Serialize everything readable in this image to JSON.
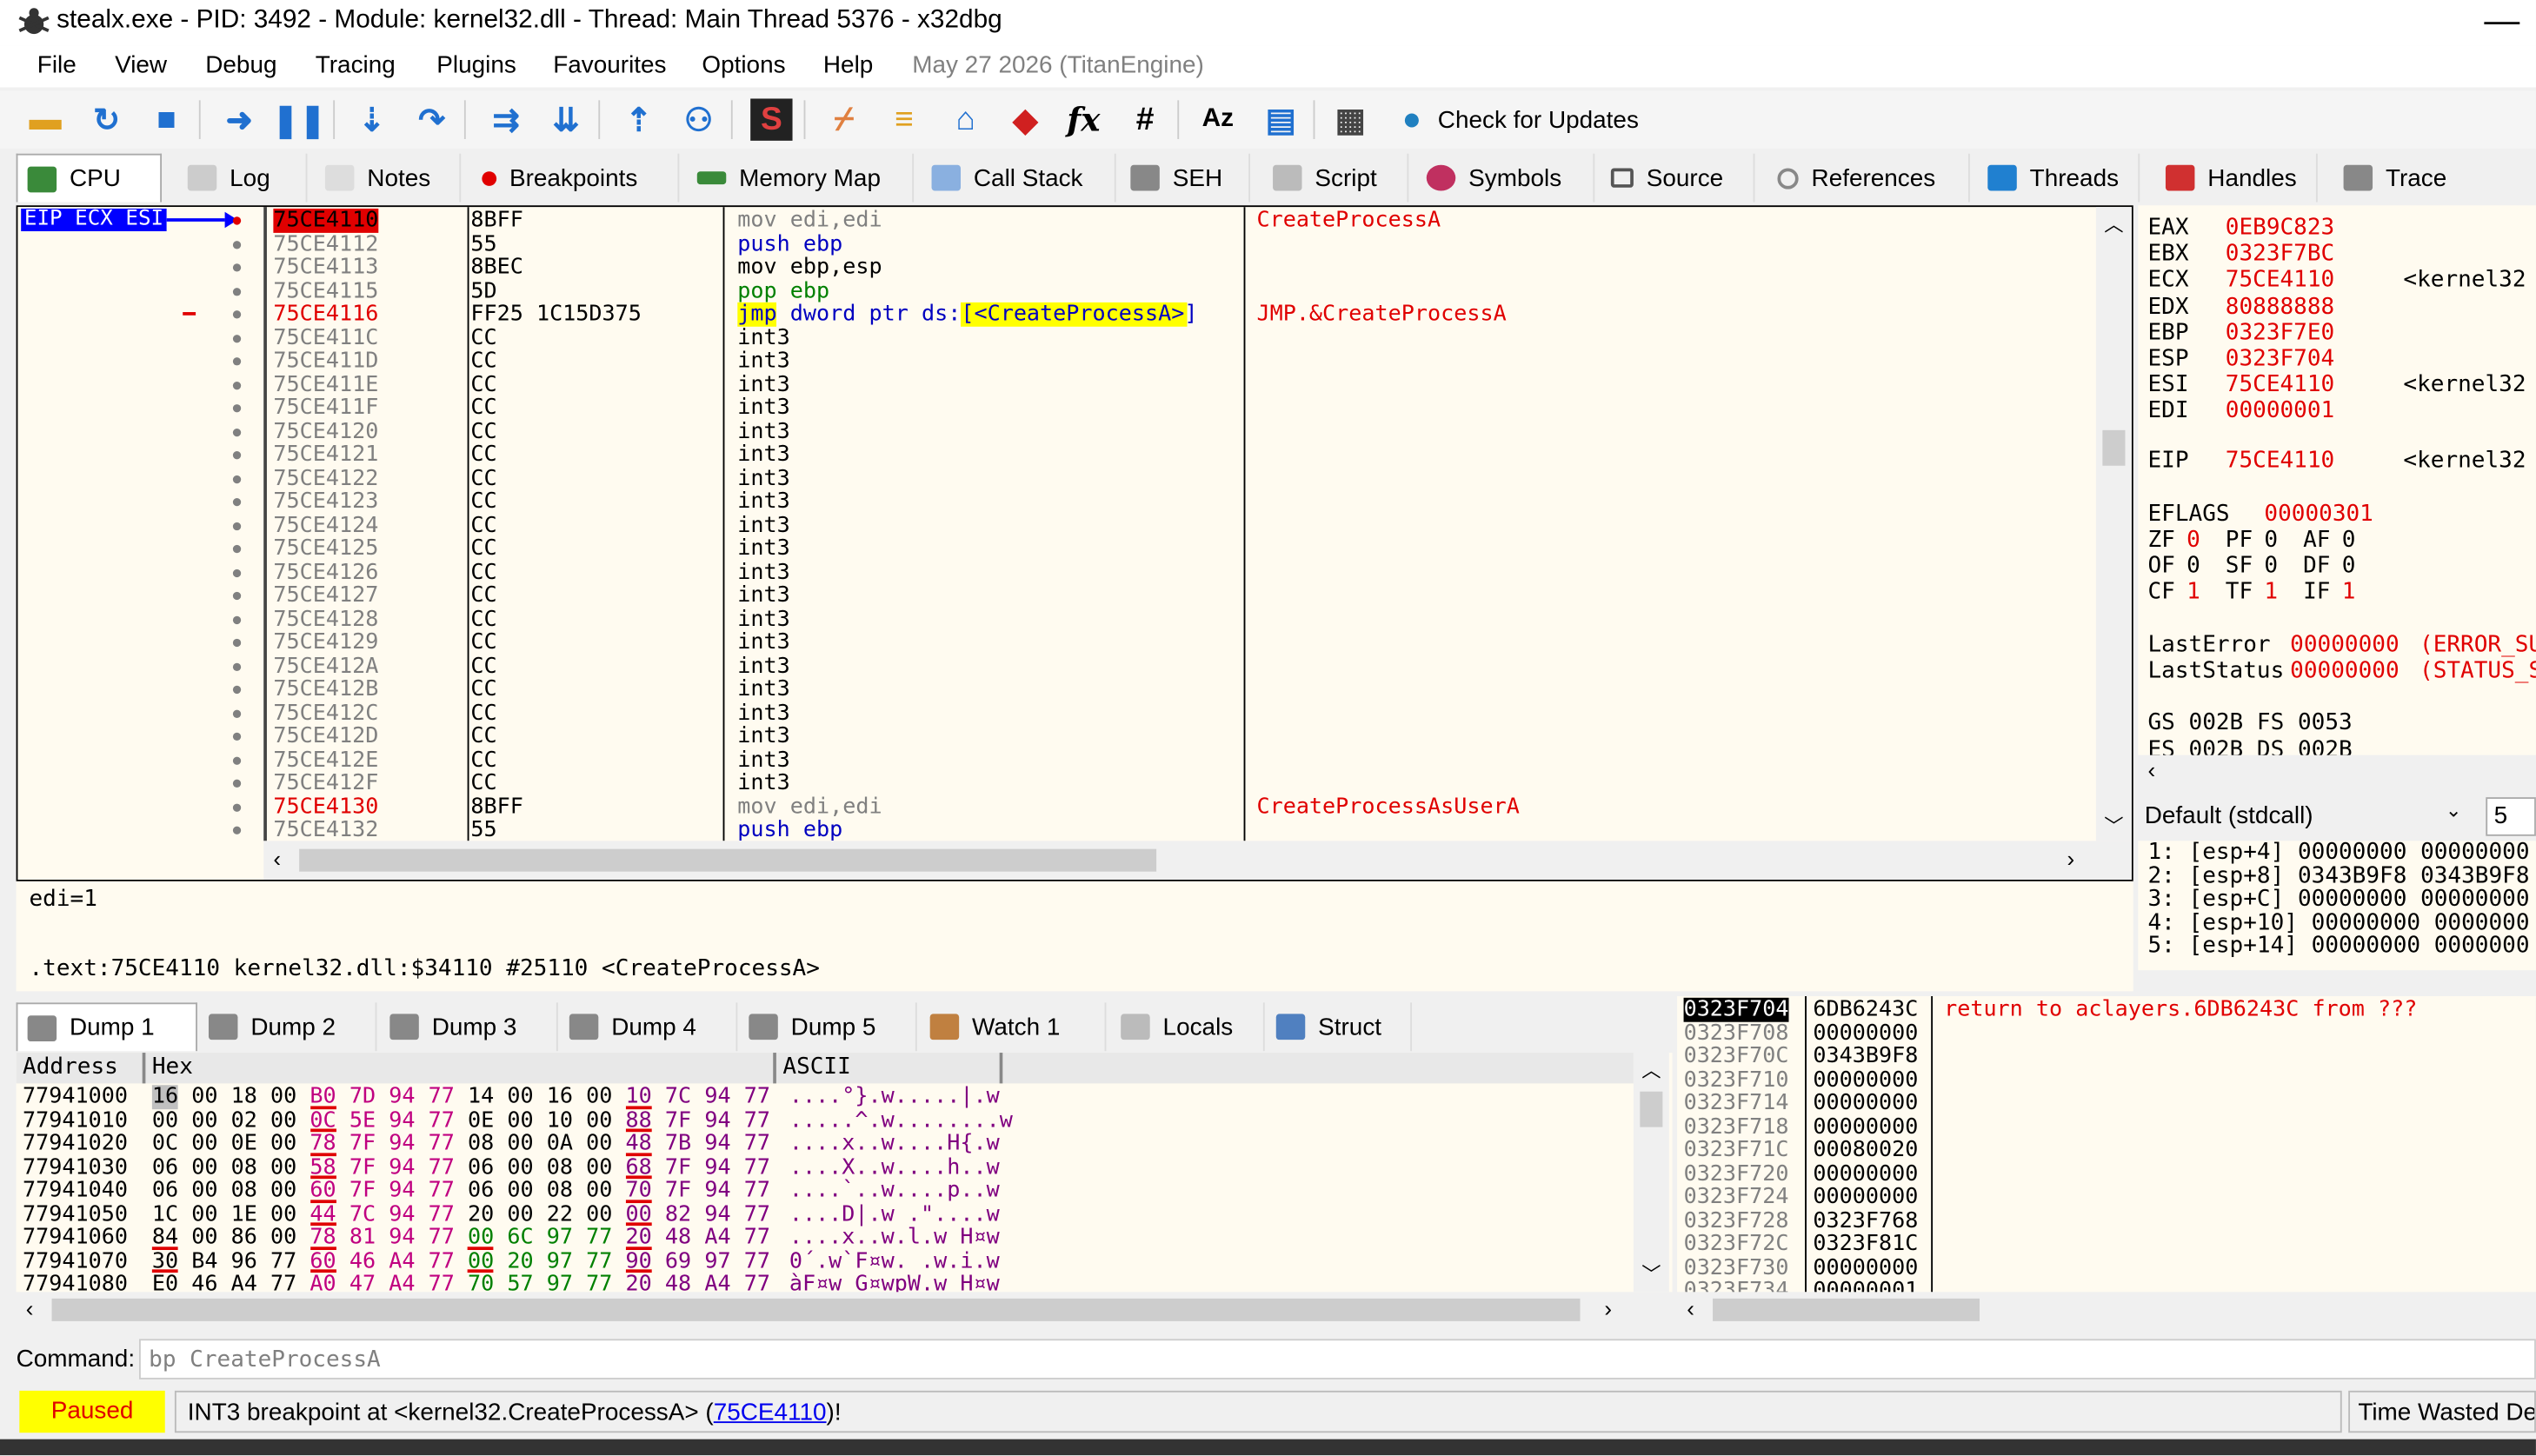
{
  "title": "stealx.exe - PID: 3492 - Module: kernel32.dll - Thread: Main Thread 5376 - x32dbg",
  "window_min_glyph": "—",
  "menu": {
    "items": [
      "File",
      "View",
      "Debug",
      "Tracing",
      "Plugins",
      "Favourites",
      "Options",
      "Help"
    ],
    "date": "May 27 2026 (TitanEngine)"
  },
  "toolbar": {
    "check_updates": "Check for Updates",
    "icons": [
      "open-icon",
      "restart-icon",
      "stop-icon",
      "run-icon",
      "pause-icon",
      "step-into-icon",
      "step-over-icon",
      "trace-into-icon",
      "trace-over-icon",
      "execute-till-return-icon",
      "run-to-user-code-icon",
      "scylla-icon",
      "patch-icon",
      "comment-icon",
      "label-icon",
      "bookmark-icon",
      "function-icon",
      "hash-icon",
      "strings-icon",
      "script-icon",
      "calculator-icon",
      "globe-icon"
    ],
    "fx_glyph": "fx",
    "hash_glyph": "#",
    "az_glyph": "Aᴢ"
  },
  "tabs": [
    "CPU",
    "Log",
    "Notes",
    "Breakpoints",
    "Memory Map",
    "Call Stack",
    "SEH",
    "Script",
    "Symbols",
    "Source",
    "References",
    "Threads",
    "Handles",
    "Trace"
  ],
  "eip_label": "EIP ECX ESI",
  "disasm": [
    {
      "addr": "75CE4110",
      "bytes": "8BFF",
      "ins": "mov edi,edi",
      "com": "CreateProcessA"
    },
    {
      "addr": "75CE4112",
      "bytes": "55",
      "ins": "push ebp",
      "com": ""
    },
    {
      "addr": "75CE4113",
      "bytes": "8BEC",
      "ins": "mov ebp,esp",
      "com": ""
    },
    {
      "addr": "75CE4115",
      "bytes": "5D",
      "ins": "pop ebp",
      "com": ""
    },
    {
      "addr": "75CE4116",
      "bytes": "FF25 1C15D375",
      "ins": "jmp dword ptr ds:[<CreateProcessA>]",
      "com": "JMP.&CreateProcessA"
    },
    {
      "addr": "75CE411C",
      "bytes": "CC",
      "ins": "int3",
      "com": ""
    },
    {
      "addr": "75CE411D",
      "bytes": "CC",
      "ins": "int3",
      "com": ""
    },
    {
      "addr": "75CE411E",
      "bytes": "CC",
      "ins": "int3",
      "com": ""
    },
    {
      "addr": "75CE411F",
      "bytes": "CC",
      "ins": "int3",
      "com": ""
    },
    {
      "addr": "75CE4120",
      "bytes": "CC",
      "ins": "int3",
      "com": ""
    },
    {
      "addr": "75CE4121",
      "bytes": "CC",
      "ins": "int3",
      "com": ""
    },
    {
      "addr": "75CE4122",
      "bytes": "CC",
      "ins": "int3",
      "com": ""
    },
    {
      "addr": "75CE4123",
      "bytes": "CC",
      "ins": "int3",
      "com": ""
    },
    {
      "addr": "75CE4124",
      "bytes": "CC",
      "ins": "int3",
      "com": ""
    },
    {
      "addr": "75CE4125",
      "bytes": "CC",
      "ins": "int3",
      "com": ""
    },
    {
      "addr": "75CE4126",
      "bytes": "CC",
      "ins": "int3",
      "com": ""
    },
    {
      "addr": "75CE4127",
      "bytes": "CC",
      "ins": "int3",
      "com": ""
    },
    {
      "addr": "75CE4128",
      "bytes": "CC",
      "ins": "int3",
      "com": ""
    },
    {
      "addr": "75CE4129",
      "bytes": "CC",
      "ins": "int3",
      "com": ""
    },
    {
      "addr": "75CE412A",
      "bytes": "CC",
      "ins": "int3",
      "com": ""
    },
    {
      "addr": "75CE412B",
      "bytes": "CC",
      "ins": "int3",
      "com": ""
    },
    {
      "addr": "75CE412C",
      "bytes": "CC",
      "ins": "int3",
      "com": ""
    },
    {
      "addr": "75CE412D",
      "bytes": "CC",
      "ins": "int3",
      "com": ""
    },
    {
      "addr": "75CE412E",
      "bytes": "CC",
      "ins": "int3",
      "com": ""
    },
    {
      "addr": "75CE412F",
      "bytes": "CC",
      "ins": "int3",
      "com": ""
    },
    {
      "addr": "75CE4130",
      "bytes": "8BFF",
      "ins": "mov edi,edi",
      "com": "CreateProcessAsUserA"
    },
    {
      "addr": "75CE4132",
      "bytes": "55",
      "ins": "push ebp",
      "com": ""
    }
  ],
  "info": {
    "line1": "edi=1",
    "line2": ".text:75CE4110 kernel32.dll:$34110 #25110 <CreateProcessA>"
  },
  "regs": [
    {
      "name": "EAX",
      "val": "0EB9C823",
      "extra": ""
    },
    {
      "name": "EBX",
      "val": "0323F7BC",
      "extra": ""
    },
    {
      "name": "ECX",
      "val": "75CE4110",
      "extra": "<kernel32"
    },
    {
      "name": "EDX",
      "val": "80888888",
      "extra": ""
    },
    {
      "name": "EBP",
      "val": "0323F7E0",
      "extra": ""
    },
    {
      "name": "ESP",
      "val": "0323F704",
      "extra": ""
    },
    {
      "name": "ESI",
      "val": "75CE4110",
      "extra": "<kernel32"
    },
    {
      "name": "EDI",
      "val": "00000001",
      "extra": ""
    }
  ],
  "eip": {
    "name": "EIP",
    "val": "75CE4110",
    "extra": "<kernel32"
  },
  "eflags": {
    "name": "EFLAGS",
    "val": "00000301"
  },
  "flags": [
    [
      "ZF",
      "0",
      "PF",
      "0",
      "AF",
      "0"
    ],
    [
      "OF",
      "0",
      "SF",
      "0",
      "DF",
      "0"
    ],
    [
      "CF",
      "1",
      "TF",
      "1",
      "IF",
      "1"
    ]
  ],
  "lasterror": {
    "name": "LastError",
    "val": "00000000",
    "extra": "(ERROR_SU"
  },
  "laststatus": {
    "name": "LastStatus",
    "val": "00000000",
    "extra": "(STATUS_S"
  },
  "segs": {
    "line": "GS 002B  FS 0053",
    "line2": "ES 002B  DS 002B"
  },
  "callconv": {
    "value": "Default (stdcall)",
    "count": "5"
  },
  "args": [
    "1: [esp+4]  00000000  00000000",
    "2: [esp+8]  0343B9F8  0343B9F8",
    "3: [esp+C]  00000000  00000000",
    "4: [esp+10]  00000000  0000000",
    "5: [esp+14]  00000000  0000000"
  ],
  "dumptabs": [
    "Dump 1",
    "Dump 2",
    "Dump 3",
    "Dump 4",
    "Dump 5",
    "Watch 1",
    "Locals",
    "Struct"
  ],
  "dump": {
    "headers": {
      "addr": "Address",
      "hex": "Hex",
      "ascii": "ASCII"
    },
    "rows": [
      {
        "addr": "77941000",
        "hex": [
          "16",
          "00",
          "18",
          "00",
          "B0",
          "7D",
          "94",
          "77",
          "14",
          "00",
          "16",
          "00",
          "10",
          "7C",
          "94",
          "77"
        ],
        "ascii": "....°}.w.....|.w"
      },
      {
        "addr": "77941010",
        "hex": [
          "00",
          "00",
          "02",
          "00",
          "0C",
          "5E",
          "94",
          "77",
          "0E",
          "00",
          "10",
          "00",
          "88",
          "7F",
          "94",
          "77"
        ],
        "ascii": ".....^.w........w"
      },
      {
        "addr": "77941020",
        "hex": [
          "0C",
          "00",
          "0E",
          "00",
          "78",
          "7F",
          "94",
          "77",
          "08",
          "00",
          "0A",
          "00",
          "48",
          "7B",
          "94",
          "77"
        ],
        "ascii": "....x..w....H{.w"
      },
      {
        "addr": "77941030",
        "hex": [
          "06",
          "00",
          "08",
          "00",
          "58",
          "7F",
          "94",
          "77",
          "06",
          "00",
          "08",
          "00",
          "68",
          "7F",
          "94",
          "77"
        ],
        "ascii": "....X..w....h..w"
      },
      {
        "addr": "77941040",
        "hex": [
          "06",
          "00",
          "08",
          "00",
          "60",
          "7F",
          "94",
          "77",
          "06",
          "00",
          "08",
          "00",
          "70",
          "7F",
          "94",
          "77"
        ],
        "ascii": "....`..w....p..w"
      },
      {
        "addr": "77941050",
        "hex": [
          "1C",
          "00",
          "1E",
          "00",
          "44",
          "7C",
          "94",
          "77",
          "20",
          "00",
          "22",
          "00",
          "00",
          "82",
          "94",
          "77"
        ],
        "ascii": "....D|.w .\"....w"
      },
      {
        "addr": "77941060",
        "hex": [
          "84",
          "00",
          "86",
          "00",
          "78",
          "81",
          "94",
          "77",
          "00",
          "6C",
          "97",
          "77",
          "20",
          "48",
          "A4",
          "77"
        ],
        "ascii": "....x..w.l.w H¤w"
      },
      {
        "addr": "77941070",
        "hex": [
          "30",
          "B4",
          "96",
          "77",
          "60",
          "46",
          "A4",
          "77",
          "00",
          "20",
          "97",
          "77",
          "90",
          "69",
          "97",
          "77"
        ],
        "ascii": "0´.w`F¤w. .w.i.w"
      },
      {
        "addr": "77941080",
        "hex": [
          "E0",
          "46",
          "A4",
          "77",
          "A0",
          "47",
          "A4",
          "77",
          "70",
          "57",
          "97",
          "77",
          "20",
          "48",
          "A4",
          "77"
        ],
        "ascii": "àF¤w G¤wpW.w H¤w"
      }
    ]
  },
  "stack": [
    {
      "addr": "0323F704",
      "val": "6DB6243C",
      "com": "return to aclayers.6DB6243C from ???"
    },
    {
      "addr": "0323F708",
      "val": "00000000",
      "com": ""
    },
    {
      "addr": "0323F70C",
      "val": "0343B9F8",
      "com": ""
    },
    {
      "addr": "0323F710",
      "val": "00000000",
      "com": ""
    },
    {
      "addr": "0323F714",
      "val": "00000000",
      "com": ""
    },
    {
      "addr": "0323F718",
      "val": "00000000",
      "com": ""
    },
    {
      "addr": "0323F71C",
      "val": "00080020",
      "com": ""
    },
    {
      "addr": "0323F720",
      "val": "00000000",
      "com": ""
    },
    {
      "addr": "0323F724",
      "val": "00000000",
      "com": ""
    },
    {
      "addr": "0323F728",
      "val": "0323F768",
      "com": ""
    },
    {
      "addr": "0323F72C",
      "val": "0323F81C",
      "com": ""
    },
    {
      "addr": "0323F730",
      "val": "00000000",
      "com": ""
    },
    {
      "addr": "0323F734",
      "val": "00000001",
      "com": ""
    }
  ],
  "command": {
    "label": "Command:",
    "value": "bp CreateProcessA"
  },
  "status": {
    "state": "Paused",
    "message_pre": "INT3 breakpoint at <kernel32.CreateProcessA> (",
    "message_link": "75CE4110",
    "message_post": ")!",
    "right": "Time Wasted Deb"
  },
  "colors": {
    "eip_arrow": "#0000ff",
    "breakpoint": "#e00000",
    "paused": "#ffff00",
    "highlight": "#ffff00"
  }
}
